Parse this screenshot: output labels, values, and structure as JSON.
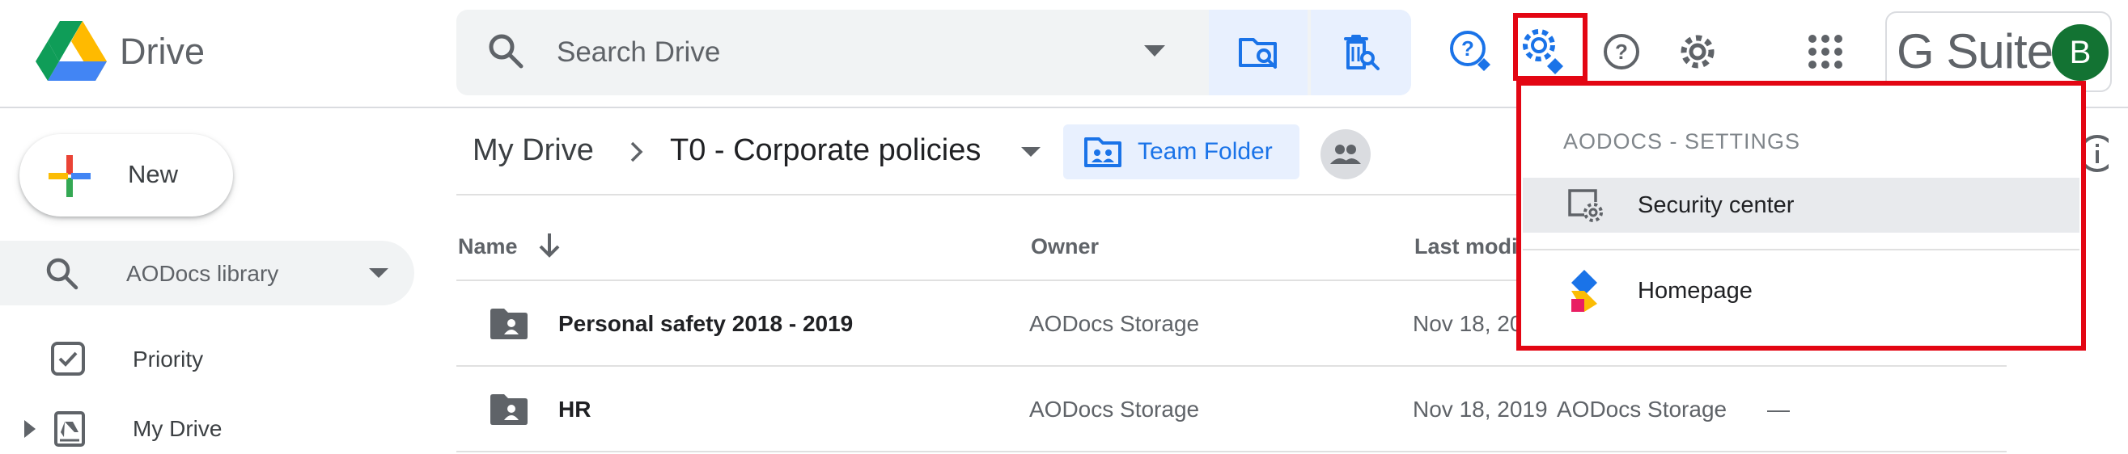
{
  "header": {
    "product_name": "Drive",
    "search_placeholder": "Search Drive",
    "brand": "G Suite",
    "avatar_initial": "B"
  },
  "icons": {
    "logo": "google-drive-logo",
    "search": "search-icon",
    "dropdown": "caret-down-icon",
    "folder_search": "folder-search-icon",
    "trash_search": "trash-search-icon",
    "help_aodocs": "help-badge-icon",
    "aodocs_settings": "gear-badge-icon",
    "help": "help-icon",
    "settings": "gear-icon",
    "apps": "apps-grid-icon"
  },
  "colors": {
    "accent": "#1a73e8",
    "highlight": "#e30613",
    "avatar": "#137333"
  },
  "sidebar": {
    "new_label": "New",
    "library_label": "AODocs library",
    "items": [
      {
        "label": "Priority"
      },
      {
        "label": "My Drive"
      }
    ]
  },
  "breadcrumb": {
    "root": "My Drive",
    "current": "T0 - Corporate policies",
    "team_folder": "Team Folder"
  },
  "table": {
    "columns": [
      "Name",
      "Owner",
      "Last modi"
    ],
    "rows": [
      {
        "name": "Personal safety 2018 - 2019",
        "owner": "AODocs Storage",
        "modified": "Nov 18, 20",
        "modified_by": "",
        "size": ""
      },
      {
        "name": "HR",
        "owner": "AODocs Storage",
        "modified": "Nov 18, 2019",
        "modified_by": "AODocs Storage",
        "size": "—"
      }
    ]
  },
  "menu": {
    "title": "AODOCS - SETTINGS",
    "items": [
      {
        "label": "Security center"
      },
      {
        "label": "Homepage"
      }
    ]
  }
}
